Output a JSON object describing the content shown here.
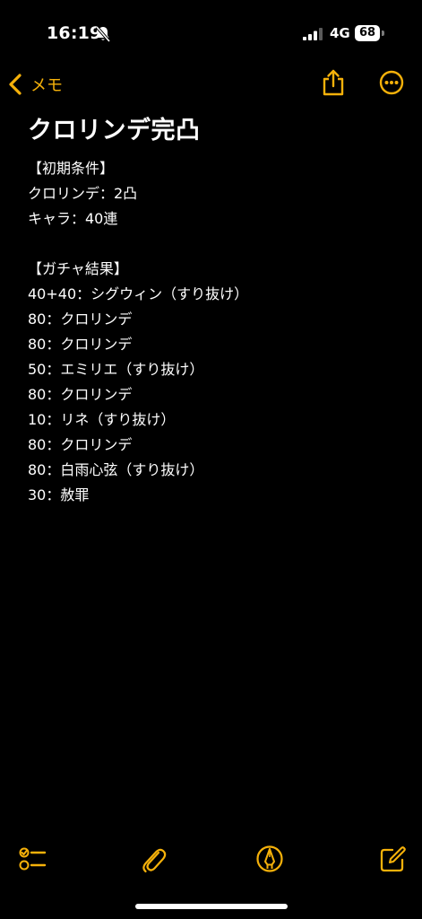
{
  "status_bar": {
    "time": "16:19",
    "network": "4G",
    "battery": "68",
    "icons": [
      "bell-slash-icon",
      "signal-icon",
      "battery-icon"
    ]
  },
  "nav": {
    "back_label": "メモ",
    "back_icon": "chevron-left-icon",
    "share_icon": "share-icon",
    "more_icon": "ellipsis-circle-icon"
  },
  "note": {
    "title": "クロリンデ完凸",
    "section1": {
      "header": "【初期条件】",
      "lines": [
        "クロリンデ：2凸",
        "キャラ：40連"
      ]
    },
    "section2": {
      "header": "【ガチャ結果】",
      "lines": [
        "40+40：シグウィン（すり抜け）",
        "80：クロリンデ",
        "80：クロリンデ",
        "50：エミリエ（すり抜け）",
        "80：クロリンデ",
        "10：リネ（すり抜け）",
        "80：クロリンデ",
        "80：白雨心弦（すり抜け）",
        "30：赦罪"
      ]
    }
  },
  "toolbar": {
    "icons": [
      "checklist-icon",
      "paperclip-icon",
      "markup-pen-icon",
      "compose-icon"
    ]
  },
  "colors": {
    "accent": "#f5b10a",
    "background": "#000000",
    "text": "#ffffff"
  }
}
